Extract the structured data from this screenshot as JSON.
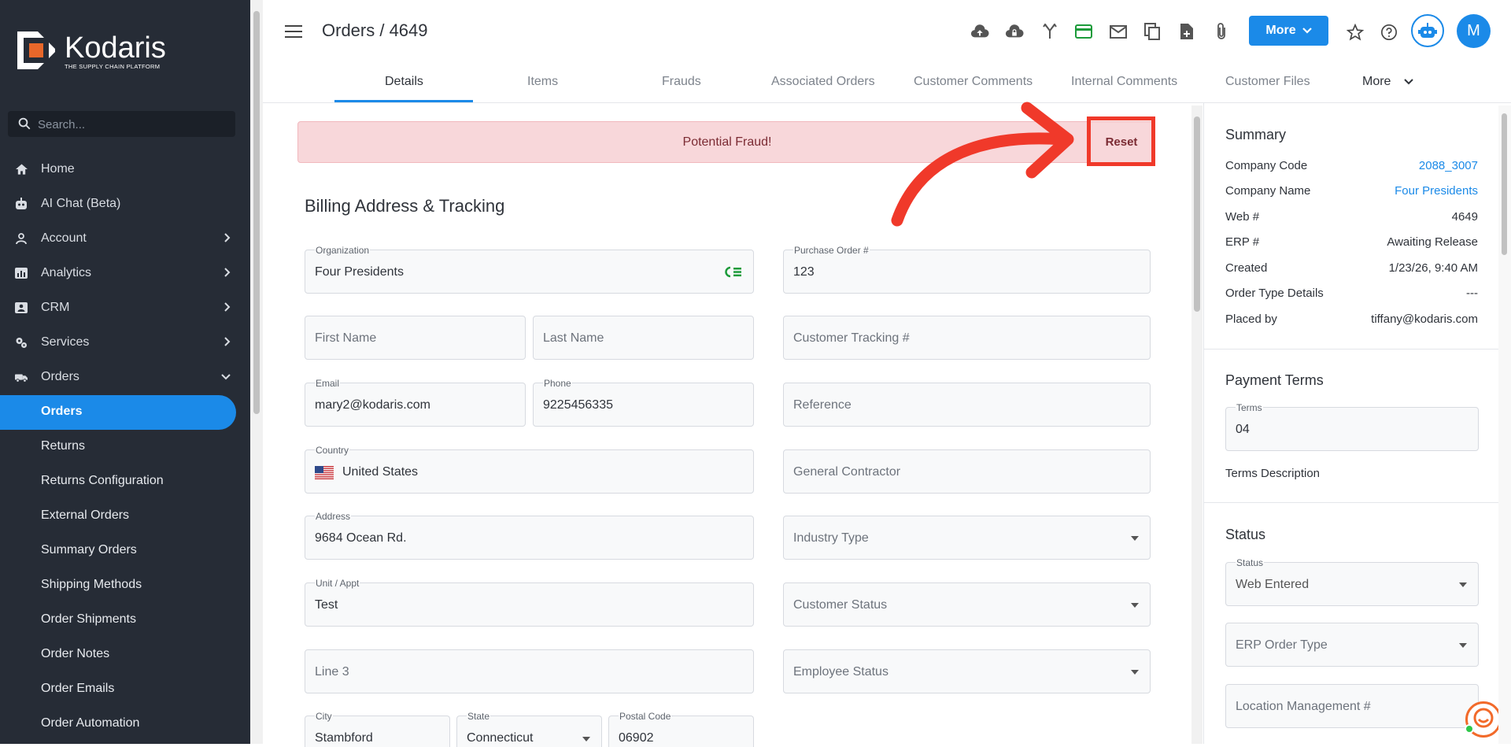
{
  "brand": {
    "name": "Kodaris",
    "tagline": "THE SUPPLY CHAIN PLATFORM"
  },
  "sidebar": {
    "search_placeholder": "Search...",
    "items": [
      {
        "label": "Home",
        "icon": "home-icon"
      },
      {
        "label": "AI Chat (Beta)",
        "icon": "robot-icon"
      },
      {
        "label": "Account",
        "icon": "person-icon"
      },
      {
        "label": "Analytics",
        "icon": "chart-icon"
      },
      {
        "label": "CRM",
        "icon": "contact-icon"
      },
      {
        "label": "Services",
        "icon": "gears-icon"
      },
      {
        "label": "Orders",
        "icon": "truck-icon"
      }
    ],
    "sub_items": [
      "Orders",
      "Returns",
      "Returns Configuration",
      "External Orders",
      "Summary Orders",
      "Shipping Methods",
      "Order Shipments",
      "Order Notes",
      "Order Emails",
      "Order Automation"
    ]
  },
  "header": {
    "title": "Orders / 4649",
    "more_label": "More",
    "avatar_initial": "M",
    "tabs": [
      "Details",
      "Items",
      "Frauds",
      "Associated Orders",
      "Customer Comments",
      "Internal Comments",
      "Customer Files",
      "More"
    ]
  },
  "alert": {
    "message": "Potential Fraud!",
    "reset_label": "Reset"
  },
  "billing": {
    "heading": "Billing Address & Tracking",
    "organization": {
      "label": "Organization",
      "value": "Four Presidents"
    },
    "purchase_order": {
      "label": "Purchase Order #",
      "value": "123"
    },
    "first_name": {
      "placeholder": "First Name"
    },
    "last_name": {
      "placeholder": "Last Name"
    },
    "customer_tracking": {
      "placeholder": "Customer Tracking #"
    },
    "email": {
      "label": "Email",
      "value": "mary2@kodaris.com"
    },
    "phone": {
      "label": "Phone",
      "value": "9225456335"
    },
    "reference": {
      "placeholder": "Reference"
    },
    "country": {
      "label": "Country",
      "value": "United States"
    },
    "general_contractor": {
      "placeholder": "General Contractor"
    },
    "address": {
      "label": "Address",
      "value": "9684 Ocean Rd."
    },
    "industry_type": {
      "placeholder": "Industry Type"
    },
    "unit": {
      "label": "Unit / Appt",
      "value": "Test"
    },
    "customer_status": {
      "placeholder": "Customer Status"
    },
    "line3": {
      "placeholder": "Line 3"
    },
    "employee_status": {
      "placeholder": "Employee Status"
    },
    "city": {
      "label": "City",
      "value": "Stambford"
    },
    "state": {
      "label": "State",
      "value": "Connecticut"
    },
    "postal": {
      "label": "Postal Code",
      "value": "06902"
    }
  },
  "summary": {
    "heading": "Summary",
    "rows": [
      {
        "key": "Company Code",
        "value": "2088_3007"
      },
      {
        "key": "Company Name",
        "value": "Four Presidents"
      },
      {
        "key": "Web #",
        "value": "4649"
      },
      {
        "key": "ERP #",
        "value": "Awaiting Release"
      },
      {
        "key": "Created",
        "value": "1/23/26, 9:40 AM"
      },
      {
        "key": "Order Type Details",
        "value": "---"
      },
      {
        "key": "Placed by",
        "value": "tiffany@kodaris.com"
      }
    ]
  },
  "payment": {
    "heading": "Payment Terms",
    "terms_label": "Terms",
    "terms_value": "04",
    "terms_description": "Terms Description"
  },
  "status": {
    "heading": "Status",
    "status_label": "Status",
    "status_value": "Web Entered",
    "erp_order_type": "ERP Order Type",
    "location_management": "Location Management #"
  },
  "colors": {
    "accent": "#1b8ae8",
    "sidebar": "#262c36",
    "alert_bg": "#f8d7da",
    "annotation": "#f0392a"
  }
}
